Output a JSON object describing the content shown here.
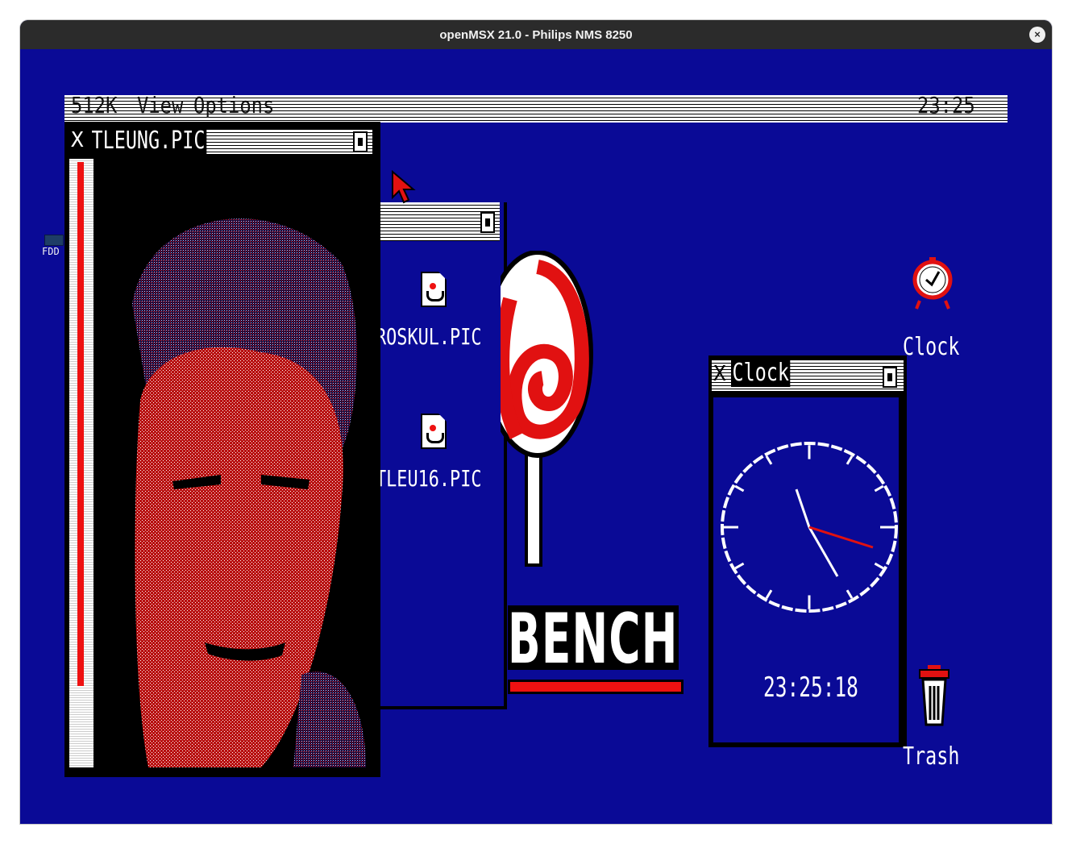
{
  "window": {
    "title": "openMSX 21.0 - Philips NMS 8250",
    "close_glyph": "×"
  },
  "menubar": {
    "memory": "512K",
    "view": "View",
    "options": "Options",
    "time": "23:25"
  },
  "desktop": {
    "fdd_label": "FDD",
    "clock_icon_label": "Clock",
    "trash_label": "Trash",
    "bench_text": "BENCH"
  },
  "picture_window": {
    "close_glyph": "X",
    "title": "TLEUNG.PIC"
  },
  "file_window": {
    "files": [
      {
        "name": "ROSKUL.PIC"
      },
      {
        "name": "TLEU16.PIC"
      }
    ]
  },
  "clock_window": {
    "close_glyph": "X",
    "title": "Clock",
    "digital_time": "23:25:18"
  },
  "colors": {
    "desktop_blue": "#0a0a96",
    "accent_red": "#e11111",
    "white": "#ffffff",
    "black": "#000000"
  },
  "icons": [
    "pointer-arrow-icon",
    "file-picture-icon",
    "lollipop-icon",
    "alarm-clock-icon",
    "trash-can-icon",
    "analog-clock-face"
  ]
}
